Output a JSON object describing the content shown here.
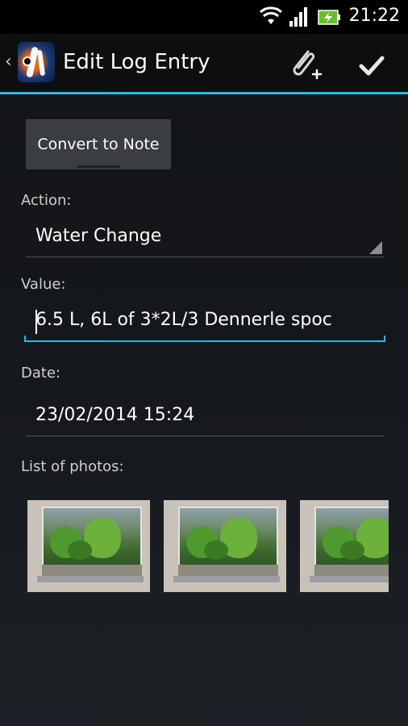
{
  "status_bar": {
    "time": "21:22",
    "icons": [
      "wifi-icon",
      "signal-icon",
      "battery-icon"
    ]
  },
  "action_bar": {
    "title": "Edit Log Entry",
    "attach_icon": "paperclip-plus-icon",
    "done_icon": "checkmark-icon"
  },
  "form": {
    "convert_button": "Convert to Note",
    "action_label": "Action:",
    "action_value": "Water Change",
    "value_label": "Value:",
    "value_text": "6.5 L, 6L of 3*2L/3 Dennerle spoc",
    "date_label": "Date:",
    "date_value": "23/02/2014 15:24",
    "photos_label": "List of photos:"
  },
  "photos": [
    {
      "name": "aquarium-photo-1"
    },
    {
      "name": "aquarium-photo-2"
    },
    {
      "name": "aquarium-photo-3"
    }
  ],
  "colors": {
    "accent": "#33b5e5",
    "action_bar": "#0d0e10",
    "background": "#15181c"
  }
}
